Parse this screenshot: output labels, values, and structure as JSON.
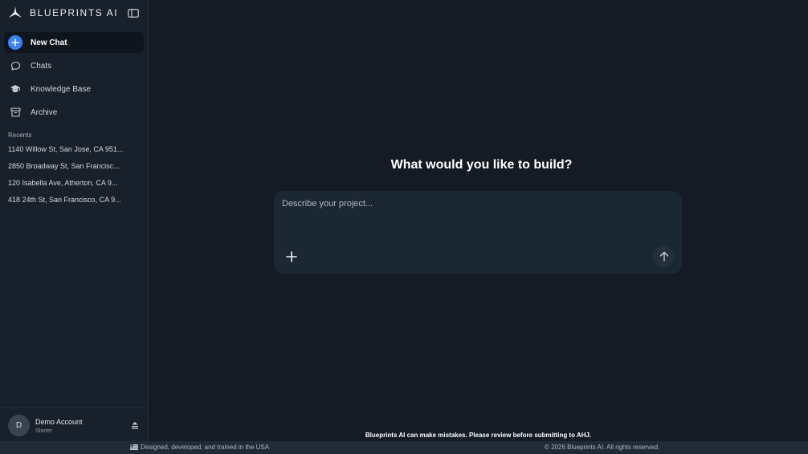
{
  "app": {
    "brand": "BLUEPRINTS AI"
  },
  "sidebar": {
    "nav": [
      {
        "label": "New Chat",
        "icon": "plus-icon"
      },
      {
        "label": "Chats",
        "icon": "chat-bubble-icon"
      },
      {
        "label": "Knowledge Base",
        "icon": "graduation-cap-icon"
      },
      {
        "label": "Archive",
        "icon": "archive-box-icon"
      }
    ],
    "recents_title": "Recents",
    "recents": [
      "1140 Willow St, San Jose, CA 951...",
      "2850 Broadway St, San Francisc...",
      "120 Isabella Ave, Atherton, CA 9...",
      "418 24th St, San Francisco, CA 9..."
    ],
    "account": {
      "initial": "D",
      "name": "Demo Account",
      "plan": "Starter"
    }
  },
  "main": {
    "heading": "What would you like to build?",
    "composer": {
      "placeholder": "Describe your project...",
      "value": ""
    },
    "disclaimer": "Blueprints AI can make mistakes. Please review before submitting to AHJ."
  },
  "footer": {
    "left": "Designed, developed, and trained in the USA",
    "right": "© 2026 Blueprints AI. All rights reserved."
  },
  "colors": {
    "background": "#141b24",
    "sidebar": "#18202b",
    "accent": "#3b82f6",
    "composer": "#1c2734",
    "footer": "#212b38"
  }
}
